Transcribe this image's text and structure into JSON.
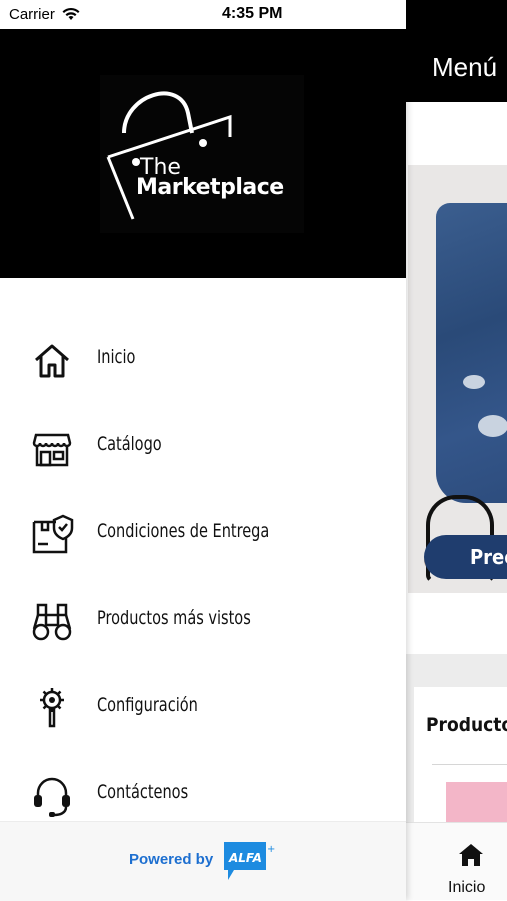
{
  "status_bar": {
    "carrier": "Carrier",
    "time": "4:35 PM"
  },
  "background_app": {
    "title": "Menú",
    "price_button_label": "Prec",
    "section_title": "Producto",
    "tab_inicio": "Inicio"
  },
  "drawer": {
    "logo": {
      "line1": "The",
      "line2": "Marketplace"
    },
    "menu": [
      {
        "label": "Inicio",
        "icon": "home-icon"
      },
      {
        "label": "Catálogo",
        "icon": "store-icon"
      },
      {
        "label": "Condiciones de Entrega",
        "icon": "delivery-box-icon"
      },
      {
        "label": "Productos más vistos",
        "icon": "binoculars-icon"
      },
      {
        "label": "Configuración",
        "icon": "settings-wrench-icon"
      },
      {
        "label": "Contáctenos",
        "icon": "headset-icon"
      }
    ],
    "footer": {
      "powered_by": "Powered by",
      "brand": "ALFA"
    }
  },
  "colors": {
    "accent": "#1d6fd0",
    "header_bg": "#000000",
    "price_button": "#1f3d6e"
  }
}
